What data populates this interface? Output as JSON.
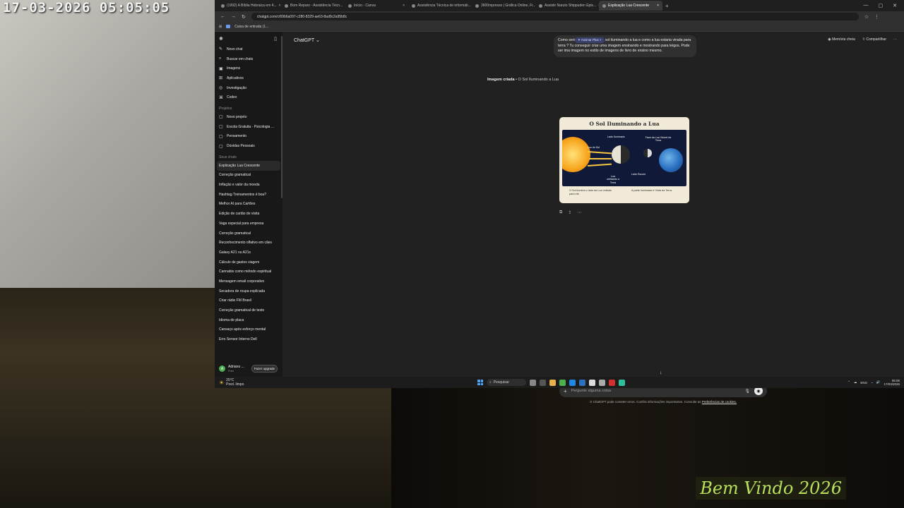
{
  "stream": {
    "timestamp": "17-03-2026  05:05:05",
    "welcome_text": "Bem Vindo 2026"
  },
  "browser": {
    "tabs": [
      {
        "label": "(1992) A Bíblia Hebraica em 4..."
      },
      {
        "label": "Bom Reparo - Assistência Técn..."
      },
      {
        "label": "Início - Canva"
      },
      {
        "label": "Assistência Técnica de informáti..."
      },
      {
        "label": "3600mpresso | Gráfica Online, Fr..."
      },
      {
        "label": "Assistir Naruto Shippuden Epis..."
      },
      {
        "label": "Explicação Lua Crescente",
        "active": true
      }
    ],
    "url": "chatgpt.com/c/69b6a097-c280-8329-ae63-8ad0c2a95b8c",
    "bookmark": "Caixa de entrada (1..."
  },
  "sidebar": {
    "nav": [
      {
        "label": "Novo chat",
        "icon": "✎"
      },
      {
        "label": "Buscar em chats",
        "icon": "⌕"
      },
      {
        "label": "Imagens",
        "icon": "▣"
      },
      {
        "label": "Aplicativos",
        "icon": "⊞"
      },
      {
        "label": "Investigação",
        "icon": "◎"
      },
      {
        "label": "Codex",
        "icon": "⌘"
      }
    ],
    "projects_heading": "Projetos",
    "projects": [
      {
        "label": "Novo projeto",
        "icon": "▢"
      },
      {
        "label": "Escola Gratuita - Psicologia ...",
        "icon": "▢"
      },
      {
        "label": "Pensamento",
        "icon": "▢"
      },
      {
        "label": "Dúvidas Pessoais",
        "icon": "▢"
      }
    ],
    "chats_heading": "Seus chats",
    "chats": [
      "Explicação Lua Crescente",
      "Correção gramatical",
      "Inflação e valor da moeda",
      "Hashtag Treinamentos é boa?",
      "Melhor AI para Cartões",
      "Edição de cartão de visita",
      "Vaga especial para empresa",
      "Correção gramatical",
      "Reconhecimento olfativo em cães",
      "Galaxy A21 ou A21s",
      "Cálculo de gastos viagem",
      "Cannabis como método espiritual",
      "Mensagem email corporativo",
      "Secadora de roupa explicada",
      "Criar rádio FM Brasil",
      "Correção gramatical de texto",
      "Idioma de placa",
      "Cansaço após esforço mental",
      "Erro Sensor Interno Dell"
    ],
    "user": {
      "initial": "A",
      "name": "Adriano ...",
      "plan": "Free",
      "upgrade_label": "Fazer upgrade"
    }
  },
  "main": {
    "model": "ChatGPT ⌄",
    "memory_label": "Memória cheia",
    "share_label": "Compartilhar",
    "user_message": "Como seria                          desse retrato do sol iluminando a lua e como a lua estaria virada para terra ? Tu conseguir criar uma imagem ensinando e mostrando para leigos. Pode ser ima imagem no estilo de imagens de livro de ensino mesmo.",
    "plus_chip": "✦ Assinar Plus  ×",
    "image_caption_bold": "Imagem criada",
    "image_caption_rest": " • O Sol Iluminando a Lua",
    "infographic": {
      "title": "O Sol Iluminando a Lua",
      "label_sunlight": "Luz do Sol",
      "label_lit": "Lado Iluminado",
      "label_visible": "Face da Lua Visível da Terra",
      "label_dark": "Lado Escuro",
      "label_orbit": "Lua orbitando a Terra",
      "foot_left": "O Sol ilumina o lado da Lua voltado para ele.",
      "foot_right": "A parte iluminada é Vista da Terra."
    },
    "composer_placeholder": "Pergunte alguma coisa",
    "disclaimer": "O ChatGPT pode cometer erros. Confira informações importantes. Consulte as",
    "disclaimer_link": "Preferências de cookies."
  },
  "taskbar": {
    "temp": "25°C",
    "weather_desc": "Pred. limpo",
    "search_label": "Pesquisar",
    "lang": "ENG",
    "time": "05:05",
    "date": "17/03/2026"
  }
}
